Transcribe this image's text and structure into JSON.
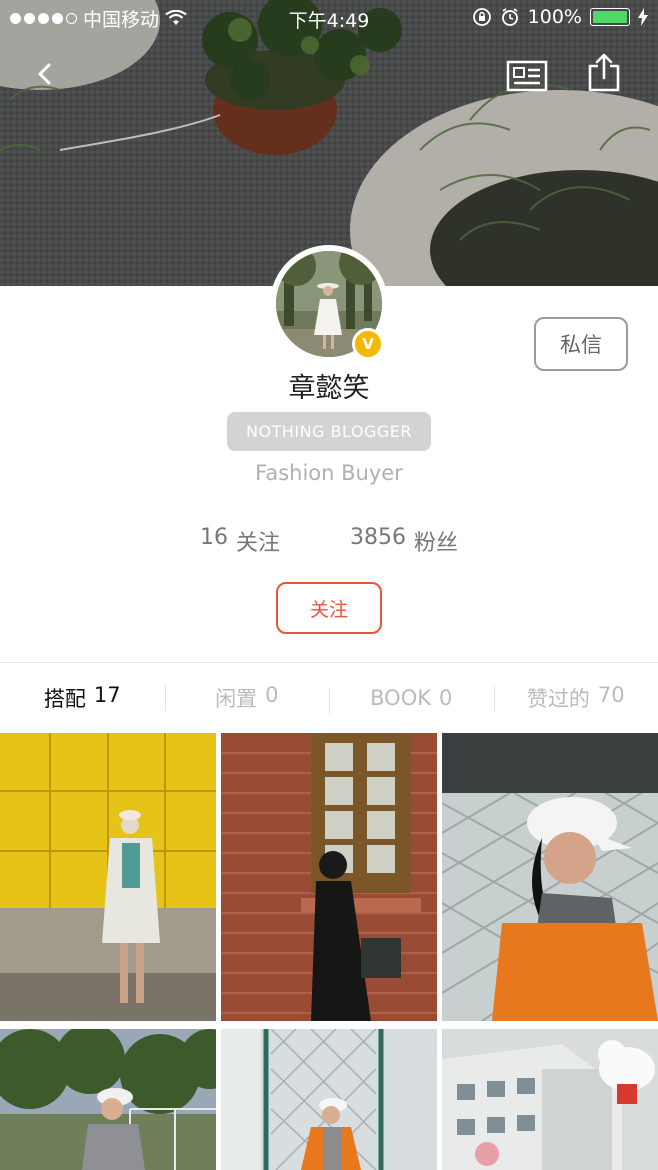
{
  "status_bar": {
    "carrier": "中国移动",
    "time": "下午4:49",
    "battery": "100%"
  },
  "nav": {
    "back_icon": "chevron-left-icon",
    "card_icon": "id-card-icon",
    "share_icon": "share-icon"
  },
  "profile": {
    "name": "章懿笑",
    "verified_badge": "V",
    "tag": "NOTHING BLOGGER",
    "subtitle": "Fashion Buyer",
    "following_count": "16",
    "following_label": "关注",
    "followers_count": "3856",
    "followers_label": "粉丝",
    "follow_button": "关注",
    "message_button": "私信"
  },
  "tabs": [
    {
      "label": "搭配",
      "count": "17",
      "active": true
    },
    {
      "label": "闲置",
      "count": "0",
      "active": false
    },
    {
      "label": "BOOK",
      "count": "0",
      "active": false
    },
    {
      "label": "赞过的",
      "count": "70",
      "active": false
    }
  ],
  "colors": {
    "accent": "#e8553d",
    "badge": "#f5b800",
    "battery": "#4cd964",
    "tag_bg": "#d3d3d3"
  }
}
